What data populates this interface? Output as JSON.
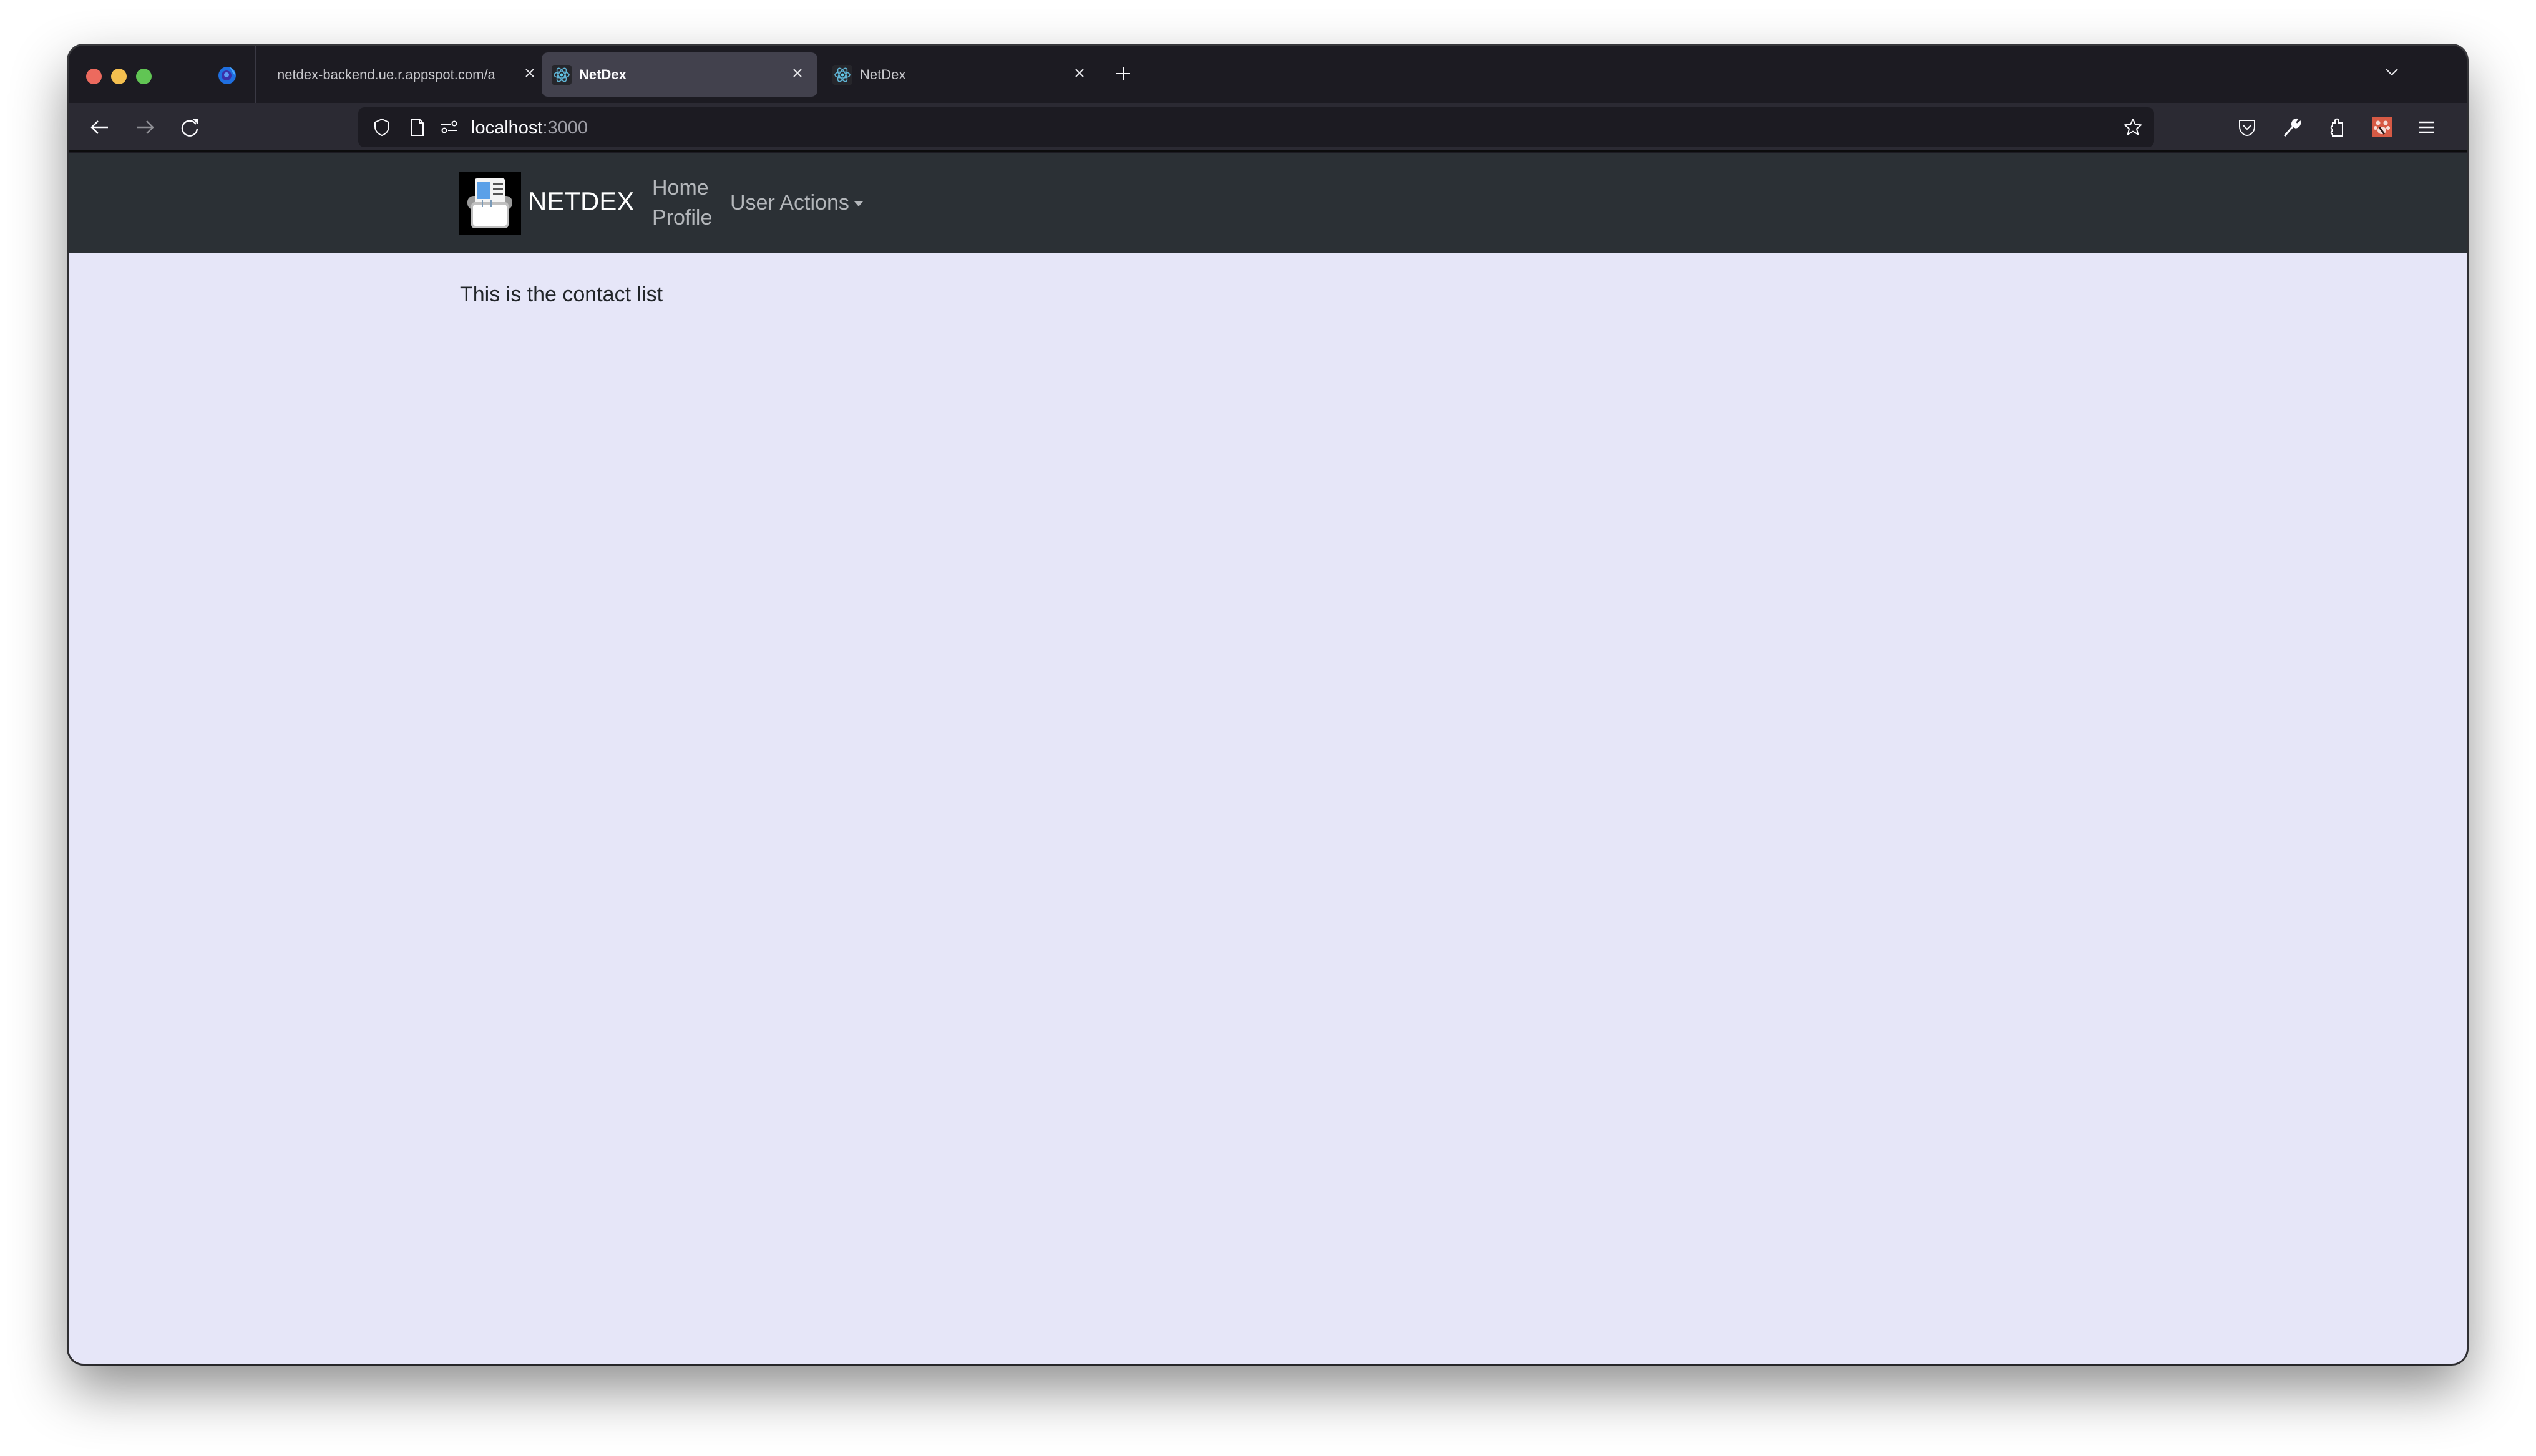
{
  "browser": {
    "tabs": [
      {
        "title": "netdex-backend.ue.r.appspot.com/a",
        "active": false,
        "has_icon": false
      },
      {
        "title": "NetDex",
        "active": true,
        "has_icon": true
      },
      {
        "title": "NetDex",
        "active": false,
        "has_icon": true
      }
    ],
    "address_bar": {
      "host": "localhost",
      "port": ":3000"
    },
    "icons": {
      "back": "arrow-left-icon",
      "forward": "arrow-right-icon",
      "reload": "reload-icon",
      "tracking": "shield-icon",
      "page_info": "page-icon",
      "permissions": "sliders-icon",
      "bookmark": "star-icon",
      "pocket": "pocket-icon",
      "devtools": "wrench-icon",
      "extensions": "puzzle-icon",
      "extension_app": "paw-extension-icon",
      "menu": "hamburger-menu-icon",
      "new_tab": "plus-icon",
      "tab_list": "chevron-down-icon"
    }
  },
  "page": {
    "navbar": {
      "brand": "NETDEX",
      "links": [
        {
          "label": "Home"
        },
        {
          "label": "Profile"
        }
      ],
      "dropdown": {
        "label": "User Actions"
      }
    },
    "content": {
      "message": "This is the contact list"
    },
    "colors": {
      "navbar_bg": "#2b3035",
      "content_bg": "#e6e6f8",
      "link_color": "#b3b6ba",
      "text_color": "#212529"
    }
  }
}
